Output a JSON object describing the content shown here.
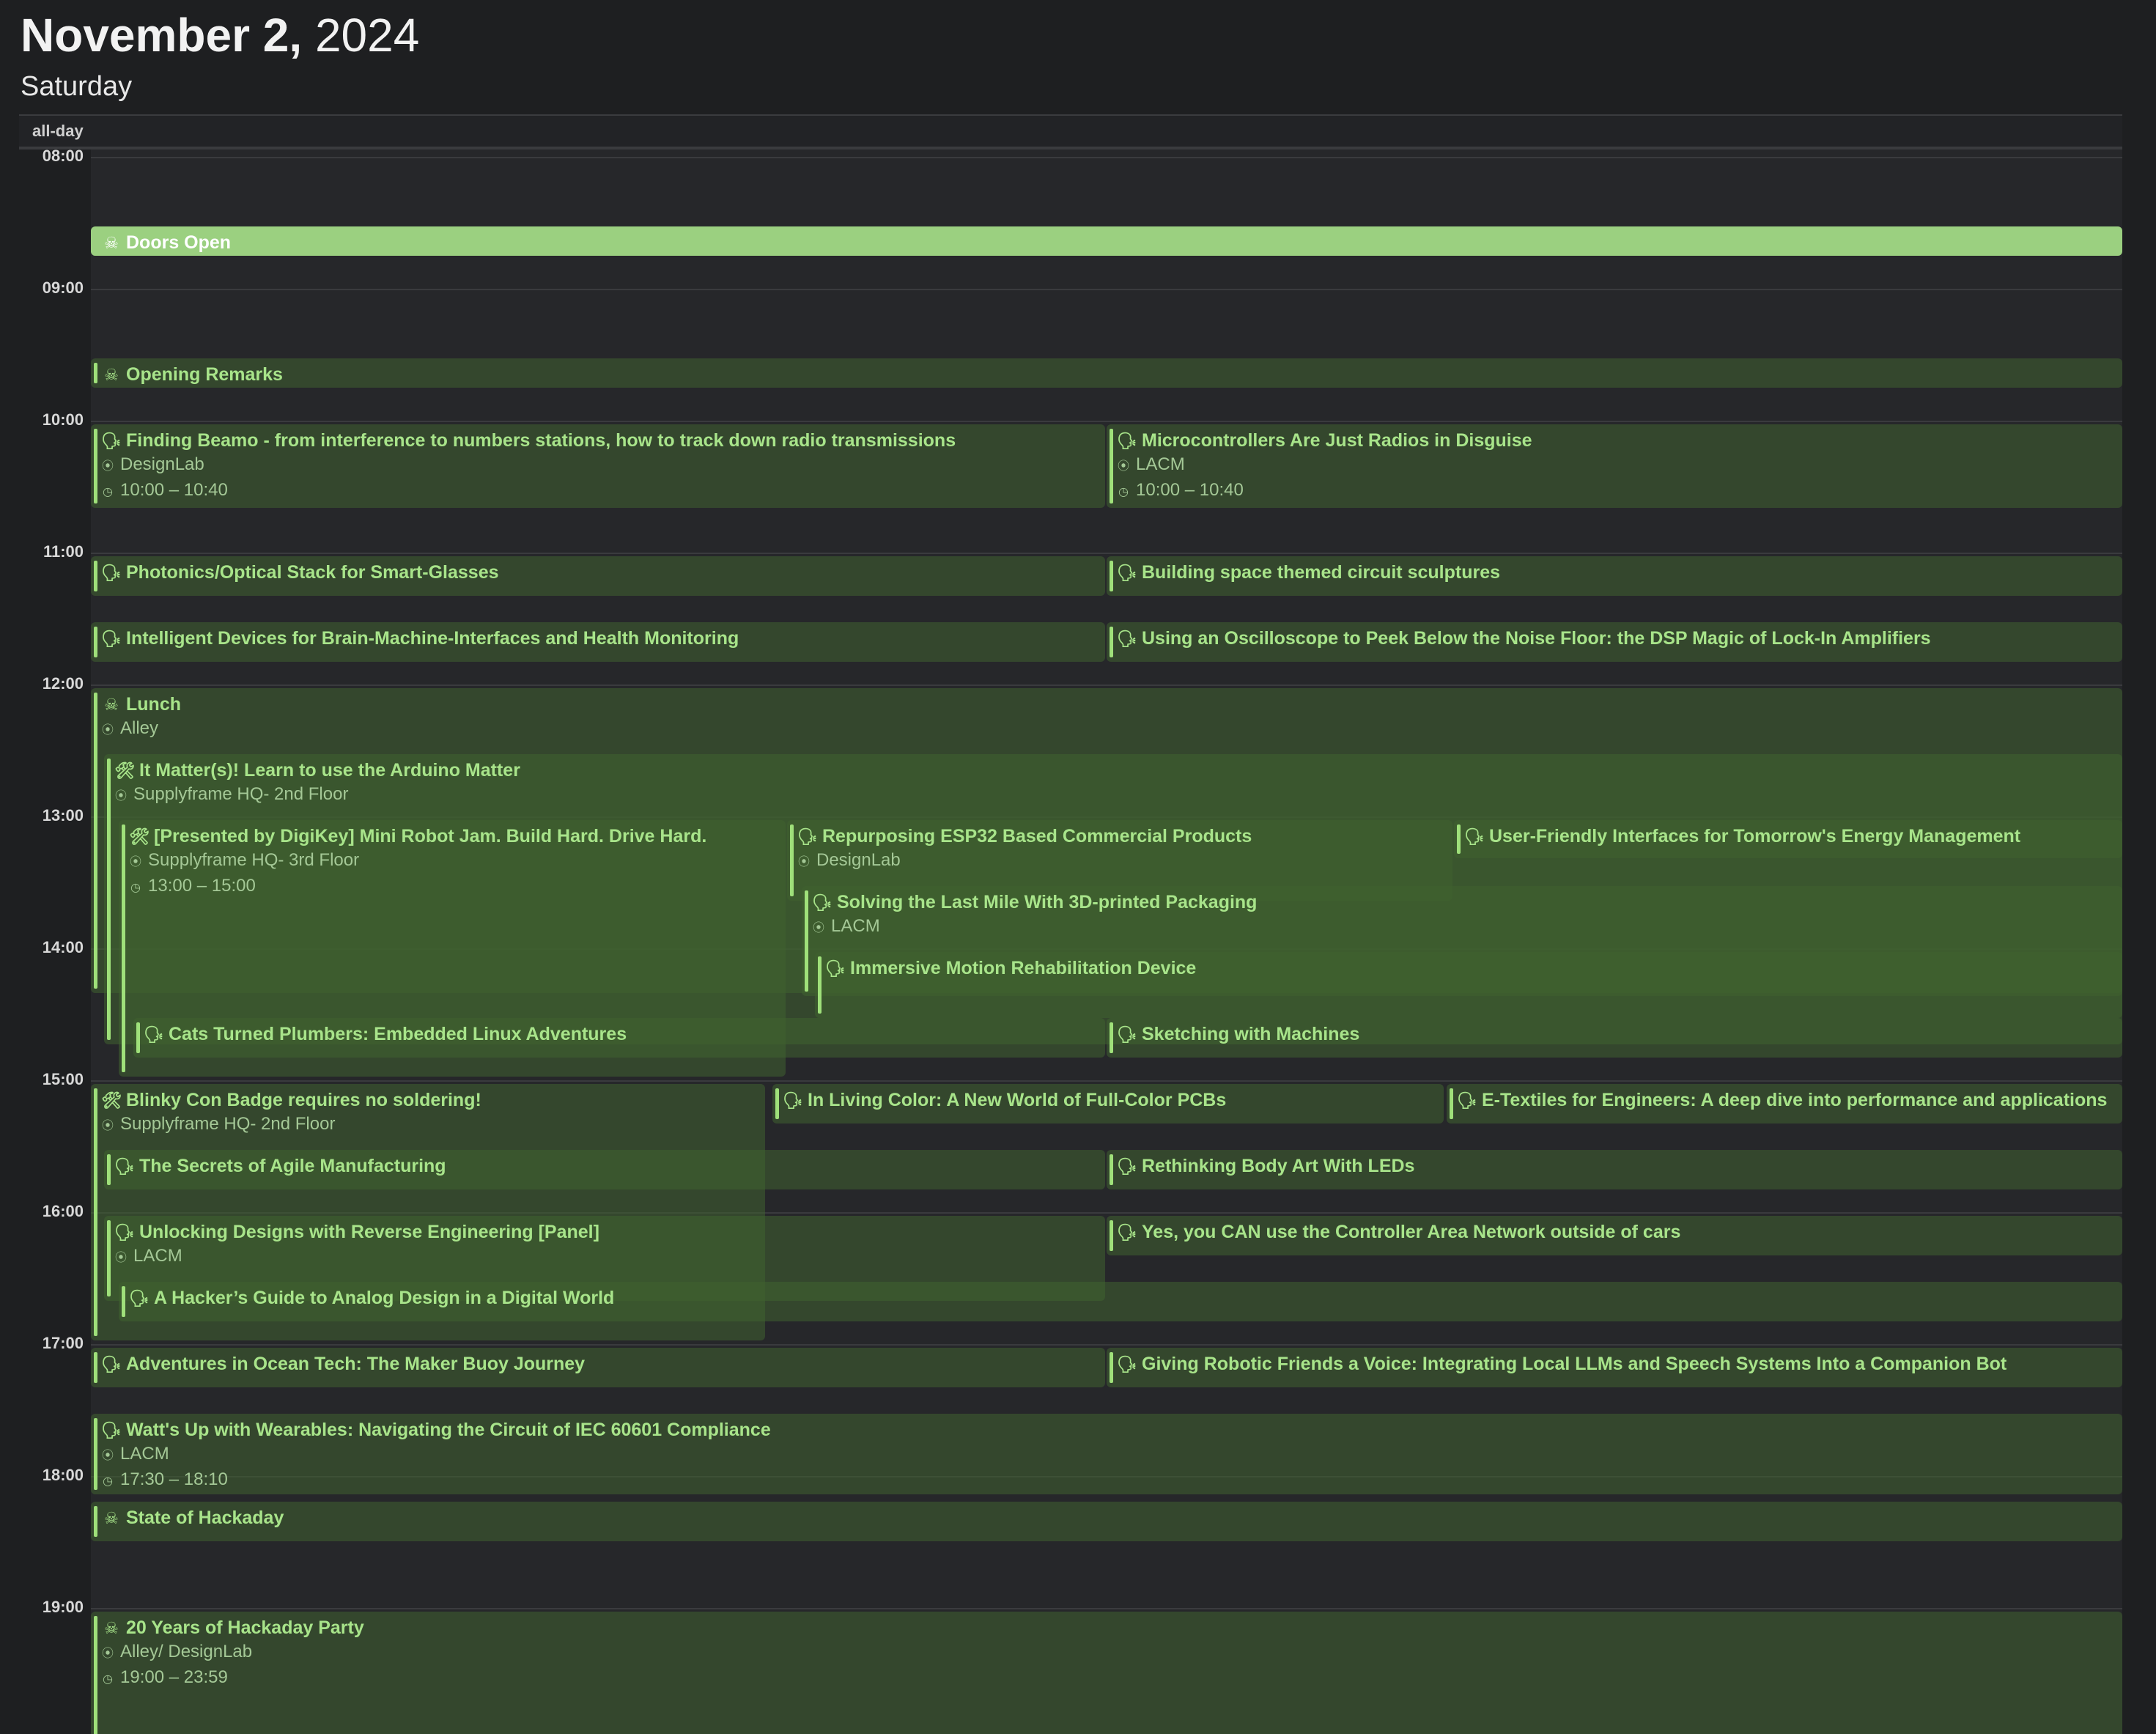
{
  "header": {
    "date": "November 2,",
    "year": "2024",
    "weekday": "Saturday"
  },
  "allday_label": "all-day",
  "hours": [
    "08:00",
    "09:00",
    "10:00",
    "11:00",
    "12:00",
    "13:00",
    "14:00",
    "15:00",
    "16:00",
    "17:00",
    "18:00",
    "19:00"
  ],
  "events": [
    {
      "title": "Doors Open",
      "icon": "skull",
      "solid": true
    },
    {
      "title": "Opening Remarks",
      "icon": "skull"
    },
    {
      "title": "Finding Beamo - from interference to numbers stations, how to track down radio transmissions",
      "icon": "speaking-head",
      "location": "DesignLab",
      "time": "10:00 – 10:40"
    },
    {
      "title": "Microcontrollers Are Just Radios in Disguise",
      "icon": "speaking-head",
      "location": "LACM",
      "time": "10:00 – 10:40"
    },
    {
      "title": "Photonics/Optical Stack for Smart-Glasses",
      "icon": "speaking-head"
    },
    {
      "title": "Building space themed circuit sculptures",
      "icon": "speaking-head"
    },
    {
      "title": "Intelligent Devices for Brain-Machine-Interfaces and Health Monitoring",
      "icon": "speaking-head"
    },
    {
      "title": "Using an Oscilloscope to Peek Below the Noise Floor: the DSP Magic of Lock-In Amplifiers",
      "icon": "speaking-head"
    },
    {
      "title": "Lunch",
      "icon": "skull",
      "location": "Alley"
    },
    {
      "title": "It Matter(s)! Learn to use the Arduino Matter",
      "icon": "tools",
      "location": "Supplyframe HQ- 2nd Floor"
    },
    {
      "title": "[Presented by DigiKey] Mini Robot Jam. Build Hard. Drive Hard.",
      "icon": "tools",
      "location": "Supplyframe HQ- 3rd Floor",
      "time": "13:00 – 15:00"
    },
    {
      "title": "Repurposing ESP32 Based Commercial Products",
      "icon": "speaking-head",
      "location": "DesignLab"
    },
    {
      "title": "User-Friendly Interfaces for Tomorrow's Energy Management",
      "icon": "speaking-head"
    },
    {
      "title": "Solving the Last Mile With 3D-printed Packaging",
      "icon": "speaking-head",
      "location": "LACM"
    },
    {
      "title": "Immersive Motion Rehabilitation Device",
      "icon": "speaking-head"
    },
    {
      "title": "Cats Turned Plumbers: Embedded Linux Adventures",
      "icon": "speaking-head"
    },
    {
      "title": "Sketching with Machines",
      "icon": "speaking-head"
    },
    {
      "title": "Blinky Con Badge requires no soldering!",
      "icon": "tools",
      "location": "Supplyframe HQ- 2nd Floor"
    },
    {
      "title": "In Living Color: A New World of Full-Color PCBs",
      "icon": "speaking-head"
    },
    {
      "title": "E-Textiles for Engineers: A deep dive into performance and applications",
      "icon": "speaking-head"
    },
    {
      "title": "The Secrets of Agile Manufacturing",
      "icon": "speaking-head"
    },
    {
      "title": "Rethinking Body Art With LEDs",
      "icon": "speaking-head"
    },
    {
      "title": "Unlocking Designs with Reverse Engineering [Panel]",
      "icon": "speaking-head",
      "location": "LACM"
    },
    {
      "title": "Yes, you CAN use the Controller Area Network outside of cars",
      "icon": "speaking-head"
    },
    {
      "title": "A Hacker’s Guide to Analog Design in a Digital World",
      "icon": "speaking-head"
    },
    {
      "title": "Adventures in Ocean Tech: The Maker Buoy Journey",
      "icon": "speaking-head"
    },
    {
      "title": "Giving Robotic Friends a Voice: Integrating Local LLMs and Speech Systems Into a Companion Bot",
      "icon": "speaking-head"
    },
    {
      "title": "Watt's Up with Wearables: Navigating the Circuit of IEC 60601 Compliance",
      "icon": "speaking-head",
      "location": "LACM",
      "time": "17:30 – 18:10"
    },
    {
      "title": "State of Hackaday",
      "icon": "skull"
    },
    {
      "title": "20 Years of Hackaday Party",
      "icon": "skull",
      "location": "Alley/ DesignLab",
      "time": "19:00 – 23:59"
    }
  ]
}
